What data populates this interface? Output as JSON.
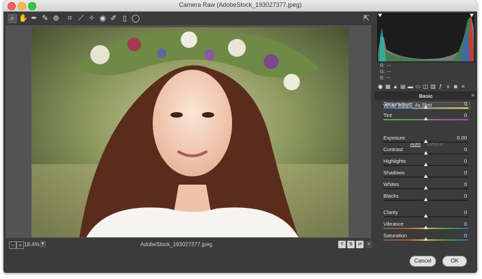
{
  "window": {
    "title": "Camera Raw (AdobeStock_193027377.jpeg)"
  },
  "toolbar": {
    "tools": [
      {
        "name": "zoom-tool",
        "glyph": "⌕",
        "active": true
      },
      {
        "name": "hand-tool",
        "glyph": "✋"
      },
      {
        "name": "white-balance-tool",
        "glyph": "✒"
      },
      {
        "name": "color-sampler-tool",
        "glyph": "✎"
      },
      {
        "name": "targeted-adjustment-tool",
        "glyph": "⊕"
      },
      {
        "name": "crop-tool",
        "glyph": "⌗"
      },
      {
        "name": "straighten-tool",
        "glyph": "⟋"
      },
      {
        "name": "spot-removal-tool",
        "glyph": "✧"
      },
      {
        "name": "red-eye-tool",
        "glyph": "◉"
      },
      {
        "name": "adjustment-brush-tool",
        "glyph": "✐"
      },
      {
        "name": "graduated-filter-tool",
        "glyph": "▯"
      },
      {
        "name": "radial-filter-tool",
        "glyph": "◯"
      }
    ]
  },
  "status": {
    "zoom": "18.4%",
    "filename": "AdobeStock_193027377.jpeg"
  },
  "histogram": {
    "r": "R:  ---",
    "g": "G:  ---",
    "b": "B:  ---"
  },
  "panel": {
    "title": "Basic",
    "white_balance_label": "White Balance:",
    "white_balance_value": "As Shot",
    "auto": "Auto",
    "default": "Default",
    "sliders": [
      {
        "label": "Temperature",
        "value": "0",
        "pos": 0.5
      },
      {
        "label": "Tint",
        "value": "0",
        "pos": 0.5
      },
      {
        "label": "Exposure",
        "value": "0.00",
        "pos": 0.5
      },
      {
        "label": "Contrast",
        "value": "0",
        "pos": 0.5
      },
      {
        "label": "Highlights",
        "value": "0",
        "pos": 0.5
      },
      {
        "label": "Shadows",
        "value": "0",
        "pos": 0.5
      },
      {
        "label": "Whites",
        "value": "0",
        "pos": 0.5
      },
      {
        "label": "Blacks",
        "value": "0",
        "pos": 0.5
      },
      {
        "label": "Clarity",
        "value": "0",
        "pos": 0.5
      },
      {
        "label": "Vibrance",
        "value": "0",
        "pos": 0.5
      },
      {
        "label": "Saturation",
        "value": "0",
        "pos": 0.5
      }
    ]
  },
  "buttons": {
    "cancel": "Cancel",
    "ok": "OK"
  }
}
